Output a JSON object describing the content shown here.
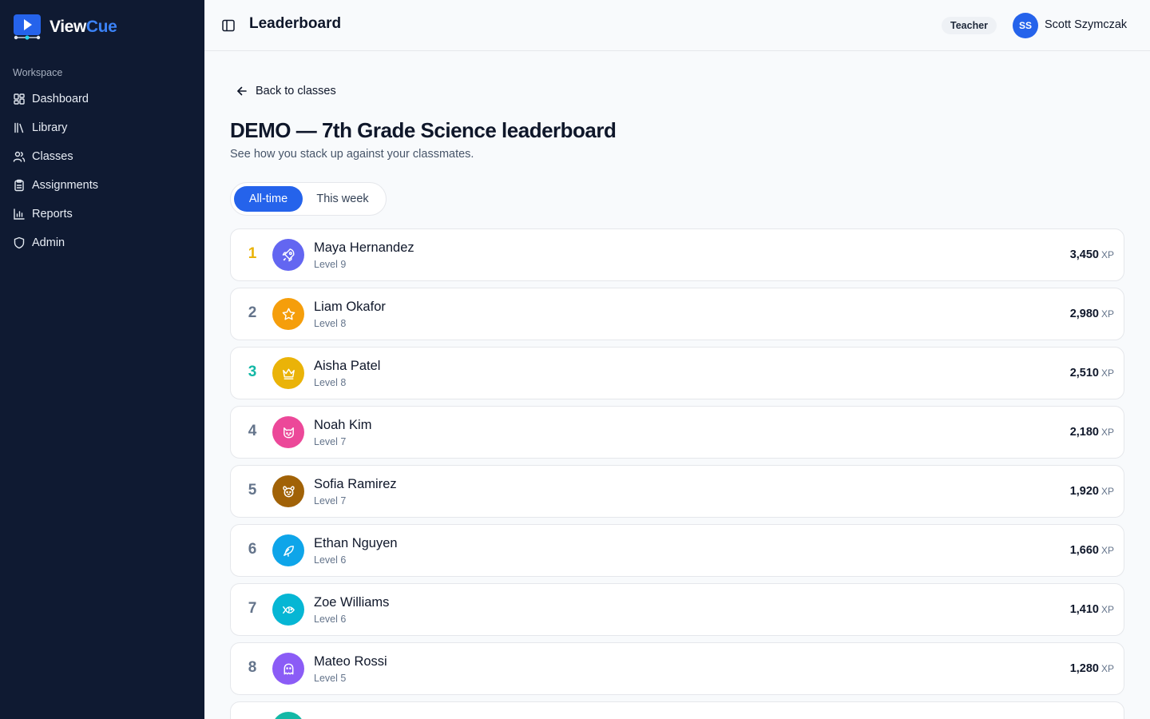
{
  "app": {
    "brand_first": "View",
    "brand_second": "Cue",
    "brand_color": "#3b82f6"
  },
  "sidebar": {
    "section_label": "Workspace",
    "items": [
      {
        "label": "Dashboard",
        "icon": "dashboard-icon"
      },
      {
        "label": "Library",
        "icon": "library-icon"
      },
      {
        "label": "Classes",
        "icon": "users-icon"
      },
      {
        "label": "Assignments",
        "icon": "clipboard-icon"
      },
      {
        "label": "Reports",
        "icon": "bar-chart-icon"
      },
      {
        "label": "Admin",
        "icon": "shield-icon"
      }
    ]
  },
  "header": {
    "title": "Leaderboard",
    "role_badge": "Teacher",
    "user_initials": "SS",
    "user_name": "Scott Szymczak"
  },
  "main": {
    "back_label": "Back to classes",
    "heading": "DEMO — 7th Grade Science leaderboard",
    "subheading": "See how you stack up against your classmates.",
    "tabs": [
      {
        "label": "All-time",
        "active": true
      },
      {
        "label": "This week",
        "active": false
      }
    ],
    "xp_unit": "XP",
    "leaderboard": [
      {
        "rank": "1",
        "name": "Maya Hernandez",
        "level": "Level 9",
        "xp": "3,450",
        "icon": "rocket-icon",
        "avatar_color": "#6366f1",
        "rank_color": "#eab308"
      },
      {
        "rank": "2",
        "name": "Liam Okafor",
        "level": "Level 8",
        "xp": "2,980",
        "icon": "star-icon",
        "avatar_color": "#f59e0b",
        "rank_color": "#64748b"
      },
      {
        "rank": "3",
        "name": "Aisha Patel",
        "level": "Level 8",
        "xp": "2,510",
        "icon": "crown-icon",
        "avatar_color": "#eab308",
        "rank_color": "#14b8a6"
      },
      {
        "rank": "4",
        "name": "Noah Kim",
        "level": "Level 7",
        "xp": "2,180",
        "icon": "cat-icon",
        "avatar_color": "#ec4899",
        "rank_color": "#64748b"
      },
      {
        "rank": "5",
        "name": "Sofia Ramirez",
        "level": "Level 7",
        "xp": "1,920",
        "icon": "dog-icon",
        "avatar_color": "#a16207",
        "rank_color": "#64748b"
      },
      {
        "rank": "6",
        "name": "Ethan Nguyen",
        "level": "Level 6",
        "xp": "1,660",
        "icon": "bird-icon",
        "avatar_color": "#0ea5e9",
        "rank_color": "#64748b"
      },
      {
        "rank": "7",
        "name": "Zoe Williams",
        "level": "Level 6",
        "xp": "1,410",
        "icon": "fish-icon",
        "avatar_color": "#06b6d4",
        "rank_color": "#64748b"
      },
      {
        "rank": "8",
        "name": "Mateo Rossi",
        "level": "Level 5",
        "xp": "1,280",
        "icon": "ghost-icon",
        "avatar_color": "#8b5cf6",
        "rank_color": "#64748b"
      },
      {
        "rank": "",
        "name": "",
        "level": "",
        "xp": "",
        "icon": "",
        "avatar_color": "#14b8a6",
        "rank_color": "#64748b"
      }
    ]
  }
}
